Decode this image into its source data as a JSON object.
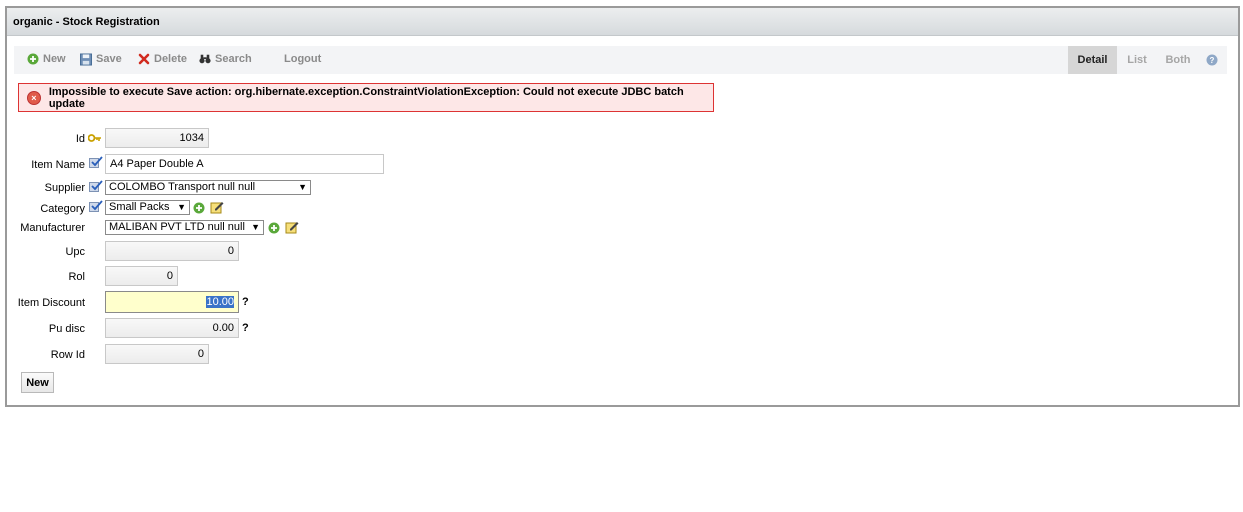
{
  "window": {
    "title": "organic - Stock Registration"
  },
  "toolbar": {
    "new_label": "New",
    "save_label": "Save",
    "delete_label": "Delete",
    "search_label": "Search",
    "logout_label": "Logout",
    "views": {
      "detail": "Detail",
      "list": "List",
      "both": "Both"
    }
  },
  "error": {
    "message": "Impossible to execute Save action: org.hibernate.exception.ConstraintViolationException: Could not execute JDBC batch update"
  },
  "form": {
    "id": {
      "label": "Id",
      "value": "1034"
    },
    "item_name": {
      "label": "Item Name",
      "value": "A4 Paper Double A"
    },
    "supplier": {
      "label": "Supplier",
      "value": "COLOMBO Transport null null"
    },
    "category": {
      "label": "Category",
      "value": "Small Packs"
    },
    "manufacturer": {
      "label": "Manufacturer",
      "value": "MALIBAN PVT LTD null null"
    },
    "upc": {
      "label": "Upc",
      "value": "0"
    },
    "rol": {
      "label": "Rol",
      "value": "0"
    },
    "item_discount": {
      "label": "Item Discount",
      "value": "10.00",
      "help": "?"
    },
    "pu_disc": {
      "label": "Pu disc",
      "value": "0.00",
      "help": "?"
    },
    "row_id": {
      "label": "Row Id",
      "value": "0"
    }
  },
  "bottom": {
    "new_label": "New"
  },
  "colors": {
    "error_border": "#dd3333",
    "error_bg": "#fde7e7",
    "focus_bg": "#ffffcc",
    "active_tab": "#d6d6d6"
  }
}
